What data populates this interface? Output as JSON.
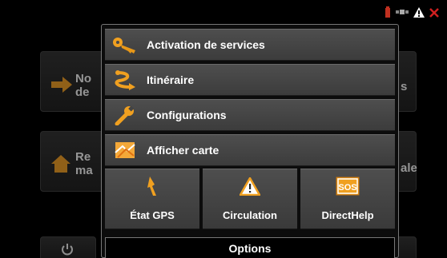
{
  "background": {
    "items": [
      {
        "label_line1": "No",
        "label_line2": "de"
      },
      {
        "label_line1": "Re",
        "label_line2": "ma"
      }
    ],
    "right_fragments": [
      "s",
      "ale"
    ]
  },
  "menu": {
    "rows": [
      {
        "label": "Activation de services",
        "icon": "key-icon"
      },
      {
        "label": "Itinéraire",
        "icon": "route-icon"
      },
      {
        "label": "Configurations",
        "icon": "wrench-icon"
      },
      {
        "label": "Afficher carte",
        "icon": "map-icon"
      }
    ],
    "tiles": [
      {
        "label": "État GPS",
        "icon": "gps-antenna-icon"
      },
      {
        "label": "Circulation",
        "icon": "warning-triangle-icon"
      },
      {
        "label": "DirectHelp",
        "icon": "sos-icon",
        "icon_text": "SOS"
      }
    ],
    "options_label": "Options"
  },
  "colors": {
    "accent": "#f0a020",
    "panel": "#444444",
    "text": "#ffffff"
  }
}
